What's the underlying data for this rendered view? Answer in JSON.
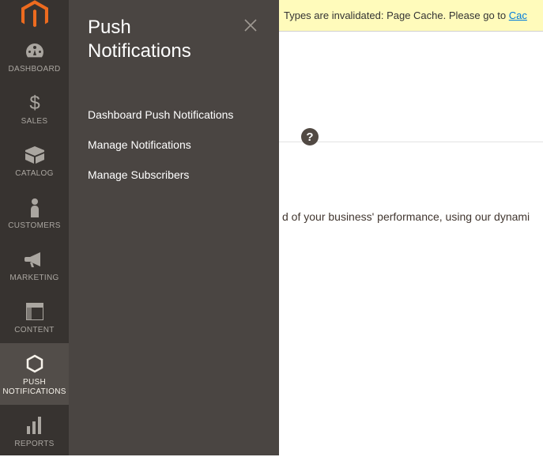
{
  "sidebar": {
    "items": [
      {
        "label": "DASHBOARD",
        "icon": "gauge-icon"
      },
      {
        "label": "SALES",
        "icon": "dollar-icon"
      },
      {
        "label": "CATALOG",
        "icon": "box-icon"
      },
      {
        "label": "CUSTOMERS",
        "icon": "person-icon"
      },
      {
        "label": "MARKETING",
        "icon": "megaphone-icon"
      },
      {
        "label": "CONTENT",
        "icon": "layout-icon"
      },
      {
        "label": "PUSH NOTIFICATIONS",
        "icon": "hexagon-icon"
      },
      {
        "label": "REPORTS",
        "icon": "bars-icon"
      }
    ]
  },
  "flyout": {
    "title": "Push Notifications",
    "items": [
      "Dashboard Push Notifications",
      "Manage Notifications",
      "Manage Subscribers"
    ]
  },
  "banner": {
    "text_before_link": "Types are invalidated: Page Cache. Please go to ",
    "link_text": "Cac"
  },
  "help_tooltip": "?",
  "body_text": "d of your business' performance, using our dynami"
}
